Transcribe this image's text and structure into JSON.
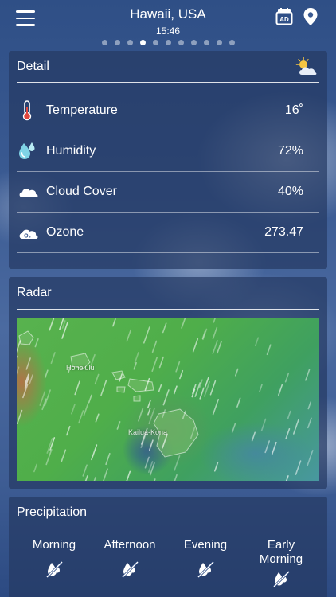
{
  "header": {
    "city": "Hawaii, USA",
    "time": "15:46",
    "page_count": 11,
    "active_page": 3,
    "icons": [
      "menu-icon",
      "ad-icon",
      "location-pin-icon"
    ]
  },
  "detail": {
    "title": "Detail",
    "header_icon": "partly-sunny-icon",
    "rows": [
      {
        "icon": "thermometer-icon",
        "label": "Temperature",
        "value": "16˚"
      },
      {
        "icon": "humidity-drops-icon",
        "label": "Humidity",
        "value": "72%"
      },
      {
        "icon": "cloud-icon",
        "label": "Cloud Cover",
        "value": "40%"
      },
      {
        "icon": "ozone-cloud-icon",
        "label": "Ozone",
        "value": "273.47"
      }
    ]
  },
  "radar": {
    "title": "Radar",
    "labels": {
      "city_1": "Honolulu",
      "city_2": "Kailua-Kona"
    }
  },
  "precipitation": {
    "title": "Precipitation",
    "periods": [
      {
        "label": "Morning",
        "icon": "no-rain-icon"
      },
      {
        "label": "Afternoon",
        "icon": "no-rain-icon"
      },
      {
        "label": "Evening",
        "icon": "no-rain-icon"
      },
      {
        "label": "Early Morning",
        "icon": "no-rain-icon"
      }
    ]
  },
  "colors": {
    "card_bg": "#263a64",
    "temperature_accent": "#e0473d",
    "humidity_accent": "#7fd3e6",
    "radar_green": "#4fae4a"
  }
}
